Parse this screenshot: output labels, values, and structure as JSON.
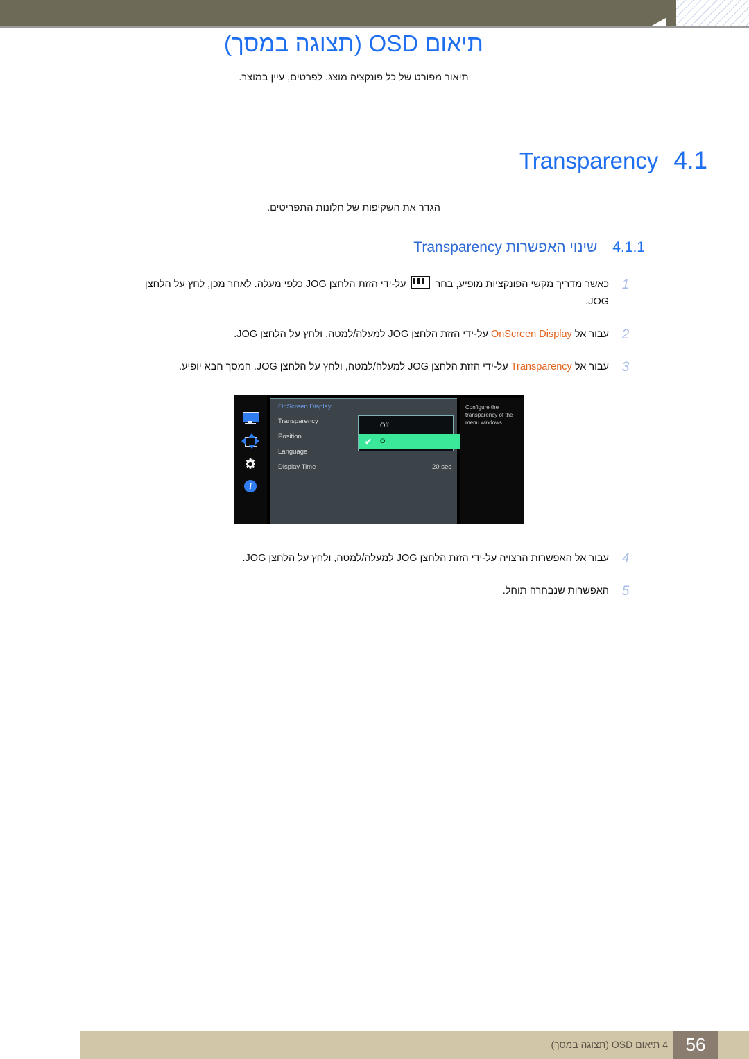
{
  "page": {
    "title": "תיאום OSD (תצוגה במסך)",
    "subtitle": "תיאור מפורט של כל פונקציה מוצג. לפרטים, עיין במוצר.",
    "accent_blue": "#1e6ef0",
    "band_color": "#6d6b57",
    "footer_bar_color": "#d2c6a8",
    "keyword_orange": "#e2621a"
  },
  "section": {
    "number": "4.1",
    "title": "Transparency",
    "description": "הגדר את השקיפות של חלונות התפריטים."
  },
  "subsection": {
    "number": "4.1.1",
    "title": "שינוי האפשרות Transparency"
  },
  "steps_top": [
    {
      "num": "1",
      "text_a": "כאשר מדריך מקשי הפונקציות מופיע, בחר ",
      "text_b": " על-ידי הזזת הלחצן JOG כלפי מעלה. לאחר מכן, לחץ על הלחצן JOG.",
      "has_glyph": true,
      "glyph": "menu-bars-icon"
    },
    {
      "num": "2",
      "text_a": "עבור אל ",
      "keyword": "OnScreen Display",
      "text_b": " על-ידי הזזת הלחצן JOG למעלה/למטה, ולחץ על הלחצן JOG."
    },
    {
      "num": "3",
      "text_a": "עבור אל ",
      "keyword": "Transparency",
      "text_b": " על-ידי הזזת הלחצן JOG למעלה/למטה, ולחץ על הלחצן JOG. המסך הבא יופיע."
    }
  ],
  "steps_bottom": [
    {
      "num": "4",
      "text_a": "עבור אל האפשרות הרצויה על-ידי הזזת הלחצן JOG למעלה/למטה, ולחץ על הלחצן JOG."
    },
    {
      "num": "5",
      "text_a": "האפשרות שנבחרה תוחל."
    }
  ],
  "osd": {
    "menu_title": "OnScreen Display",
    "items": [
      {
        "label": "Transparency",
        "value": ""
      },
      {
        "label": "Position",
        "value": ""
      },
      {
        "label": "Language",
        "value": ""
      },
      {
        "label": "Display Time",
        "value": "20 sec"
      }
    ],
    "popup": {
      "options": [
        {
          "label": "Off",
          "selected": false
        },
        {
          "label": "On",
          "selected": true
        }
      ],
      "check_glyph": "✔",
      "highlight_color": "#3be89a"
    },
    "help_text": "Configure the transparency of the menu windows.",
    "info_glyph": "i",
    "icons": [
      "monitor-icon",
      "position-arrows-icon",
      "gear-icon",
      "info-icon"
    ]
  },
  "footer": {
    "text": "4 תיאום OSD (תצוגה במסך)",
    "page_number": "56"
  }
}
